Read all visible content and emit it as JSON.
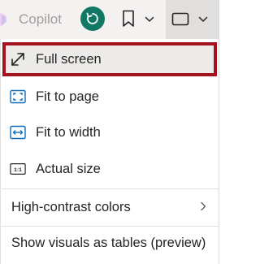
{
  "toolbar": {
    "copilot_label": "Copilot",
    "reset_icon": "reset-icon",
    "bookmark_icon": "bookmark-icon",
    "view_icon": "view-rectangle-icon",
    "accent_color": "#117865"
  },
  "menu": {
    "items": [
      {
        "label": "Full screen",
        "icon": "full-screen-icon",
        "selected": true
      },
      {
        "label": "Fit to page",
        "icon": "fit-to-page-icon"
      },
      {
        "label": "Fit to width",
        "icon": "fit-to-width-icon"
      },
      {
        "label": "Actual size",
        "icon": "actual-size-icon",
        "icon_text": "1:1"
      },
      {
        "label": "High-contrast colors",
        "has_submenu": true
      },
      {
        "label": "Show visuals as tables (preview)"
      }
    ],
    "selection_border_color": "#a4121f",
    "icon_color": "#0f6cbd"
  }
}
